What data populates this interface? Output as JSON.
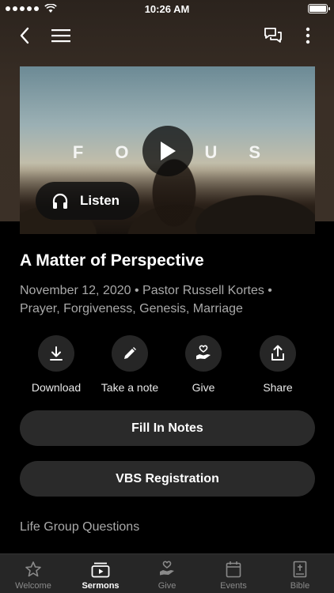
{
  "status_bar": {
    "time": "10:26 AM"
  },
  "hero": {
    "overlay_word_letters": [
      "F",
      "O",
      "",
      "U",
      "S"
    ],
    "listen_label": "Listen"
  },
  "sermon": {
    "title": "A Matter of Perspective",
    "meta_line1": "November 12, 2020 • Pastor Russell Kortes •",
    "meta_line2": "Prayer, Forgiveness, Genesis, Marriage"
  },
  "actions": [
    {
      "label": "Download",
      "icon": "download-icon"
    },
    {
      "label": "Take a note",
      "icon": "pencil-icon"
    },
    {
      "label": "Give",
      "icon": "give-heart-hand-icon"
    },
    {
      "label": "Share",
      "icon": "share-icon"
    }
  ],
  "buttons": {
    "fill_in_notes": "Fill In Notes",
    "vbs_registration": "VBS Registration"
  },
  "section": {
    "life_group_questions": "Life Group Questions"
  },
  "tabs": [
    {
      "label": "Welcome",
      "icon": "star-icon",
      "active": false
    },
    {
      "label": "Sermons",
      "icon": "play-screen-icon",
      "active": true
    },
    {
      "label": "Give",
      "icon": "give-icon",
      "active": false
    },
    {
      "label": "Events",
      "icon": "calendar-icon",
      "active": false
    },
    {
      "label": "Bible",
      "icon": "bible-icon",
      "active": false
    }
  ],
  "colors": {
    "background": "#000000",
    "top_gradient": "#3a2f26",
    "pill": "#2a2a2a",
    "tabbar": "#262626",
    "muted_text": "#a9a9a9"
  }
}
